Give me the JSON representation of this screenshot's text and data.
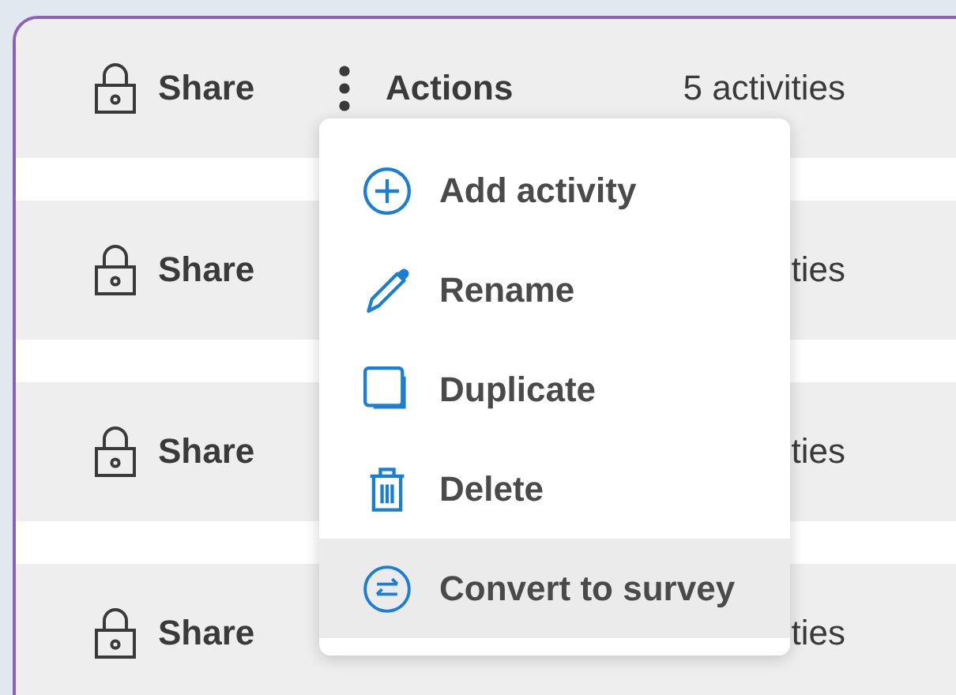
{
  "rows": [
    {
      "share_label": "Share",
      "actions_label": "Actions",
      "count": "5 activities"
    },
    {
      "share_label": "Share",
      "count": "ties"
    },
    {
      "share_label": "Share",
      "count": "ties"
    },
    {
      "share_label": "Share",
      "count": "ties"
    }
  ],
  "menu": {
    "items": [
      {
        "label": "Add activity",
        "kind": "add",
        "selected": false
      },
      {
        "label": "Rename",
        "kind": "rename",
        "selected": false
      },
      {
        "label": "Duplicate",
        "kind": "duplicate",
        "selected": false
      },
      {
        "label": "Delete",
        "kind": "delete",
        "selected": false
      },
      {
        "label": "Convert to survey",
        "kind": "convert",
        "selected": true
      }
    ]
  }
}
